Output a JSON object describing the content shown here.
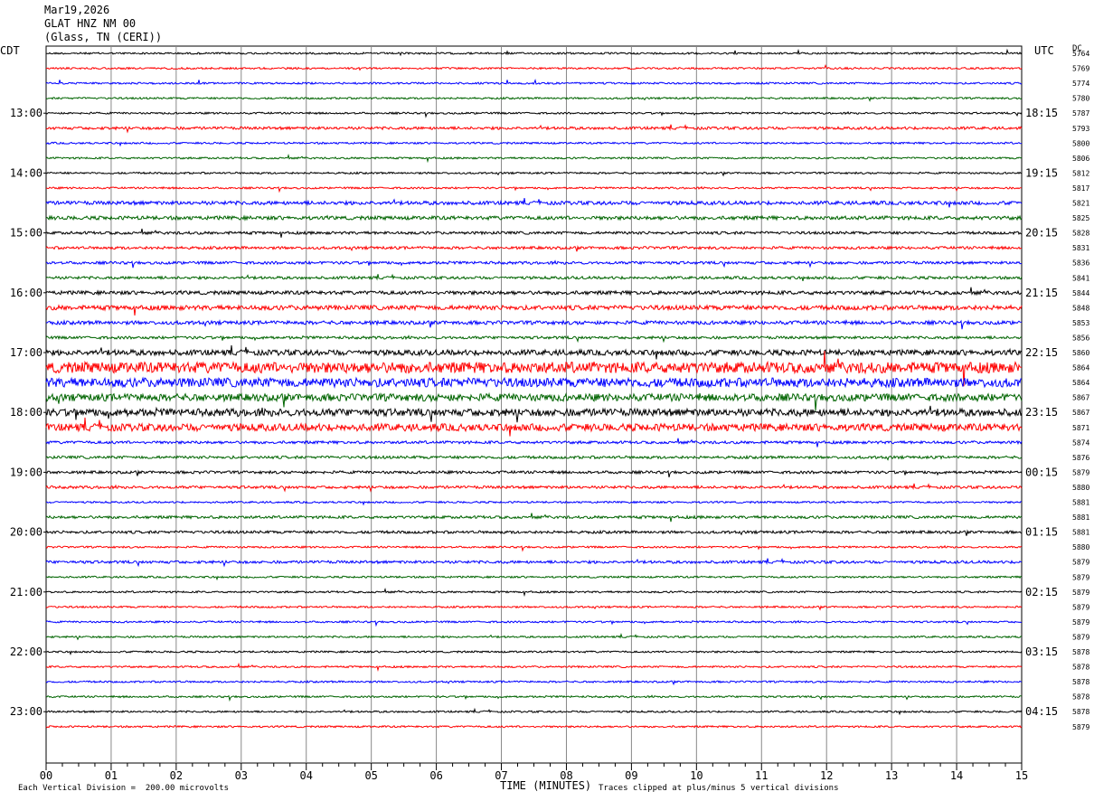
{
  "header": {
    "date": "Mar19,2026",
    "station": "GLAT HNZ NM 00",
    "location": "(Glass, TN (CERI))"
  },
  "left_axis_title": "CDT",
  "right_axis_title": "UTC",
  "dc_title": "DC",
  "footer": {
    "scale_note": "Each Vertical Division =  200.00 microvolts",
    "clip_note": "Traces clipped at plus/minus 5 vertical divisions"
  },
  "chart_data": {
    "type": "line",
    "title": "",
    "xlabel": "TIME (MINUTES)",
    "ylabel": "",
    "xlim": [
      0,
      15
    ],
    "x_ticks": [
      "00",
      "01",
      "02",
      "03",
      "04",
      "05",
      "06",
      "07",
      "08",
      "09",
      "10",
      "11",
      "12",
      "13",
      "14",
      "15"
    ],
    "left_time_labels": [
      "13:00",
      "14:00",
      "15:00",
      "16:00",
      "17:00",
      "18:00",
      "19:00",
      "20:00",
      "21:00",
      "22:00",
      "23:00"
    ],
    "right_time_labels": [
      "18:15",
      "19:15",
      "20:15",
      "21:15",
      "22:15",
      "23:15",
      "00:15",
      "01:15",
      "02:15",
      "03:15",
      "04:15"
    ],
    "trace_colors": [
      "#000000",
      "#ff0000",
      "#0000ff",
      "#006400"
    ],
    "grid": true,
    "dc_offsets": [
      5764,
      5769,
      5774,
      5780,
      5787,
      5793,
      5800,
      5806,
      5812,
      5817,
      5821,
      5825,
      5828,
      5831,
      5836,
      5841,
      5844,
      5848,
      5853,
      5856,
      5860,
      5864,
      5864,
      5867,
      5867,
      5871,
      5874,
      5876,
      5879,
      5880,
      5881,
      5881,
      5881,
      5880,
      5879,
      5879,
      5879,
      5879,
      5879,
      5879,
      5878,
      5878,
      5878,
      5878,
      5878,
      5879
    ],
    "trace_noise": [
      1,
      1,
      1,
      1,
      1,
      1.5,
      1,
      1,
      1,
      1,
      2,
      2,
      1.5,
      1.5,
      1.5,
      1.5,
      2,
      2.5,
      2,
      1.5,
      3,
      6,
      5,
      4,
      4,
      4,
      1.5,
      1.5,
      1.5,
      1.5,
      1,
      1.5,
      1.5,
      1,
      1.5,
      1,
      1,
      1,
      1,
      1,
      1,
      1,
      1,
      1,
      1,
      1
    ]
  }
}
